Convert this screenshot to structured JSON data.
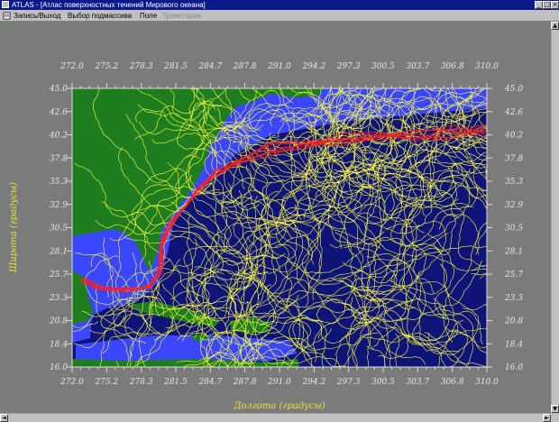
{
  "window": {
    "title": "ATLAS - [Атлас поверхностных течений Мирового океана]",
    "controls": [
      "minimize",
      "maximize",
      "close"
    ]
  },
  "menu": {
    "items": [
      {
        "label": "Запись/Выход",
        "enabled": true
      },
      {
        "label": "Выбор подмассива",
        "enabled": true
      },
      {
        "label": "Поле",
        "enabled": true
      },
      {
        "label": "Траектории",
        "enabled": false
      }
    ]
  },
  "map": {
    "x_axis_title": "Долгота (градусы)",
    "y_axis_title": "Широта (градусы)",
    "longitude_ticks": [
      "272.0",
      "275.2",
      "278.3",
      "281.5",
      "284.7",
      "287.8",
      "291.0",
      "294.2",
      "297.3",
      "300.5",
      "303.7",
      "306.8",
      "310.0"
    ],
    "latitude_ticks": [
      "45.0",
      "42.6",
      "40.2",
      "37.8",
      "35.3",
      "32.9",
      "30.5",
      "28.1",
      "25.7",
      "23.3",
      "20.8",
      "18.4",
      "16.0"
    ],
    "colors": {
      "land": "#1e7d1e",
      "shelf": "#3a46ff",
      "deep_ocean": "#0e1478",
      "drifter_tracks": "#ffff40",
      "gulf_stream_tracks": "#ff2020",
      "background": "#7b7b7b"
    }
  }
}
